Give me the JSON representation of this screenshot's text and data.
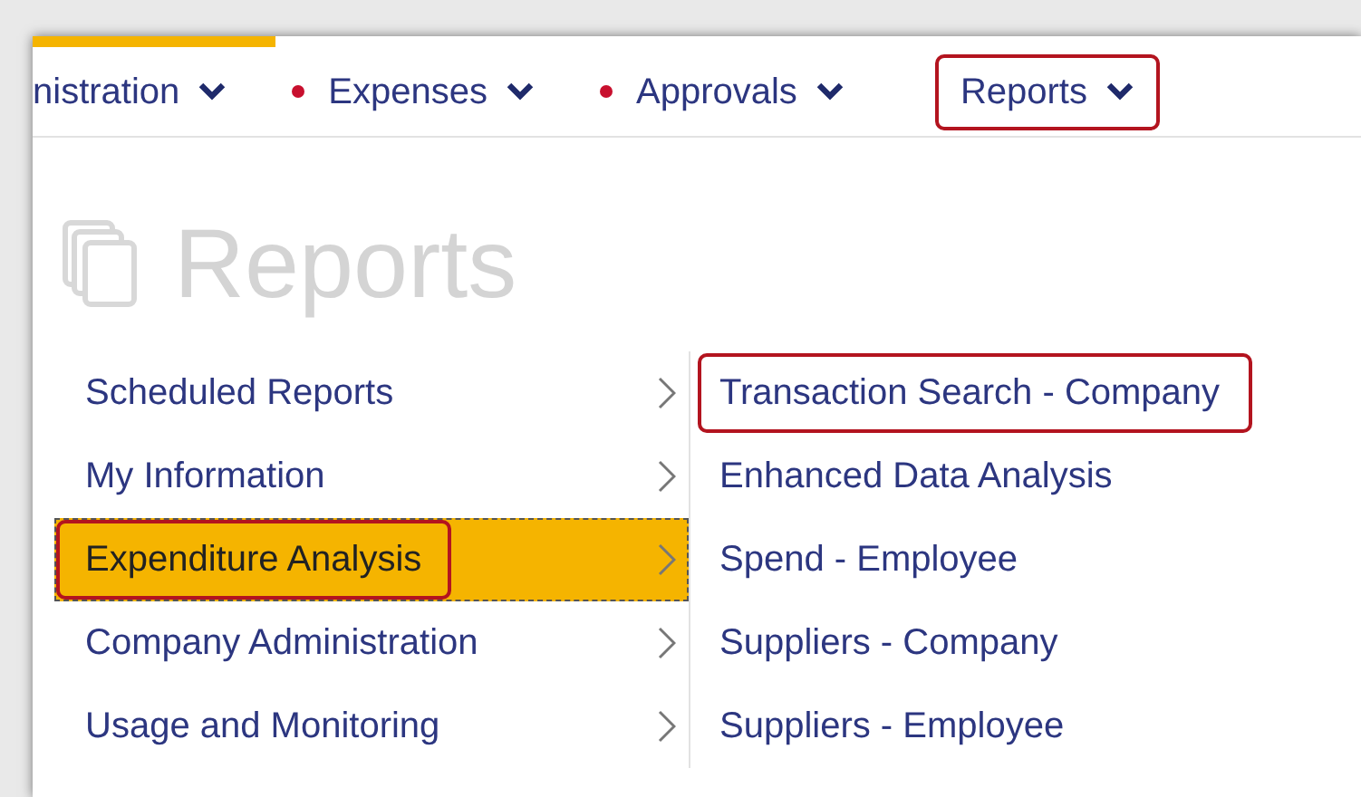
{
  "nav": [
    {
      "label": "nistration",
      "alert": false,
      "highlighted": false
    },
    {
      "label": "Expenses",
      "alert": true,
      "highlighted": false
    },
    {
      "label": "Approvals",
      "alert": true,
      "highlighted": false
    },
    {
      "label": "Reports",
      "alert": false,
      "highlighted": true
    }
  ],
  "page_title": "Reports",
  "categories": [
    {
      "label": "Scheduled Reports",
      "selected": false,
      "highlighted": false
    },
    {
      "label": "My Information",
      "selected": false,
      "highlighted": false
    },
    {
      "label": "Expenditure Analysis",
      "selected": true,
      "highlighted": true
    },
    {
      "label": "Company Administration",
      "selected": false,
      "highlighted": false
    },
    {
      "label": "Usage and Monitoring",
      "selected": false,
      "highlighted": false
    }
  ],
  "reports": [
    {
      "label": "Transaction Search - Company",
      "highlighted": true
    },
    {
      "label": "Enhanced Data Analysis",
      "highlighted": false
    },
    {
      "label": "Spend - Employee",
      "highlighted": false
    },
    {
      "label": "Suppliers - Company",
      "highlighted": false
    },
    {
      "label": "Suppliers - Employee",
      "highlighted": false
    }
  ]
}
